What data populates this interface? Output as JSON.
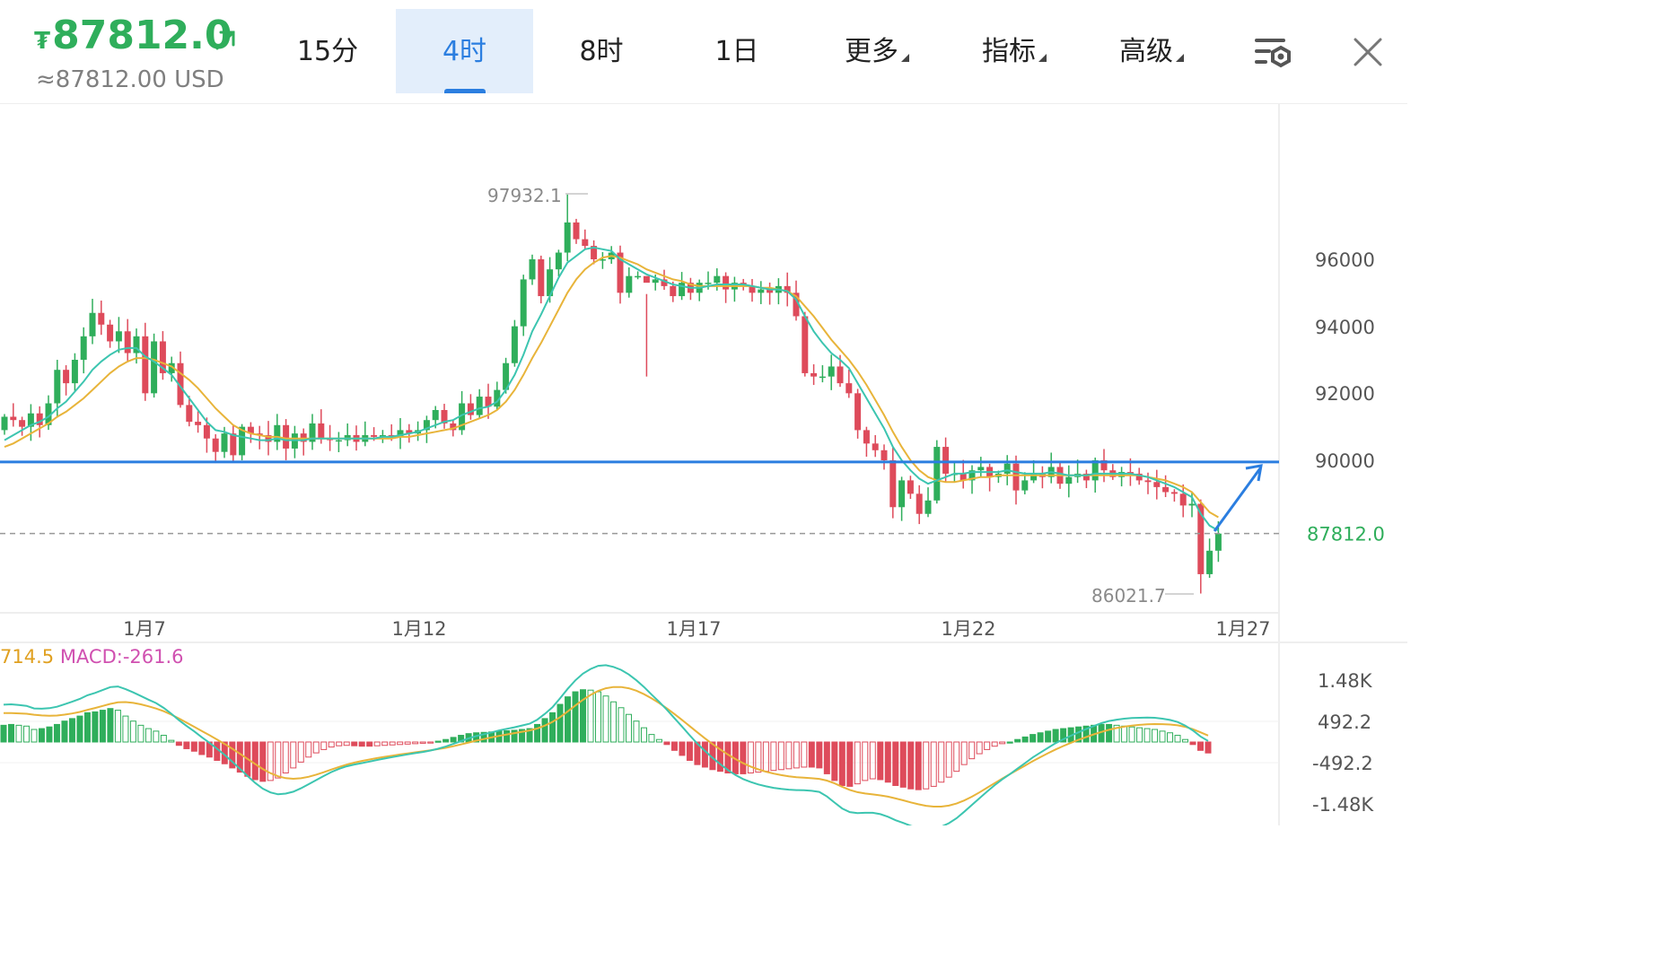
{
  "header": {
    "currency_symbol": "₮",
    "price": "87812.0",
    "converted": "≈87812.00 USD",
    "up_color": "#2fae5b"
  },
  "tabs": [
    {
      "label": "15分",
      "active": false
    },
    {
      "label": "4时",
      "active": true
    },
    {
      "label": "8时",
      "active": false
    },
    {
      "label": "1日",
      "active": false
    },
    {
      "label": "更多",
      "dropdown": true
    },
    {
      "label": "指标",
      "dropdown": true
    },
    {
      "label": "高级",
      "dropdown": true
    }
  ],
  "icons": {
    "settings": "chart-settings-icon",
    "close": "close-icon"
  },
  "chart_data": [
    {
      "type": "candlestick",
      "y_ticks": [
        "96000",
        "94000",
        "92000",
        "90000"
      ],
      "x_ticks": [
        "1月7",
        "1月12",
        "1月17",
        "1月22",
        "1月27"
      ],
      "ylim": [
        85000,
        99000
      ],
      "last_price_label": "87812.0",
      "high_label": "97932.1",
      "low_label": "86021.7",
      "horizontal_line": 89950,
      "colors": {
        "up": "#2fae5b",
        "down": "#de4b5b",
        "ma_fast": "#3cc5b0",
        "ma_slow": "#e8b43a",
        "line": "#2b7ee0"
      },
      "closes": [
        91300,
        91200,
        91000,
        91400,
        91050,
        91700,
        92700,
        92300,
        93000,
        93700,
        94400,
        94050,
        93550,
        93850,
        93200,
        93700,
        92000,
        93550,
        92600,
        92900,
        91650,
        91150,
        91050,
        90650,
        90250,
        90800,
        90150,
        91000,
        90800,
        90750,
        90550,
        91050,
        90350,
        90800,
        90550,
        91100,
        90650,
        90600,
        90600,
        90750,
        90550,
        90750,
        90700,
        90750,
        90700,
        90900,
        90800,
        90900,
        91200,
        91500,
        91100,
        90900,
        91700,
        91350,
        91900,
        91600,
        92100,
        92900,
        94000,
        95400,
        96000,
        94900,
        95700,
        96200,
        97100,
        96600,
        96400,
        96000,
        96000,
        96200,
        95000,
        95500,
        95500,
        95300,
        95400,
        95200,
        94900,
        95300,
        95000,
        95300,
        95300,
        95500,
        95100,
        95300,
        95200,
        95000,
        95100,
        95000,
        95200,
        95000,
        94300,
        92600,
        92500,
        92500,
        92800,
        92300,
        92000,
        90900,
        90500,
        90300,
        90000,
        88600,
        89400,
        89000,
        88400,
        88800,
        90400,
        89600,
        89600,
        89400,
        89700,
        89800,
        89500,
        89600,
        89900,
        89100,
        89400,
        89600,
        89500,
        89800,
        89300,
        89500,
        89600,
        89400,
        90000,
        89700,
        89500,
        89650,
        89600,
        89400,
        89350,
        89200,
        89050,
        89000,
        88650,
        88700,
        86600,
        87300,
        87812
      ],
      "ma_fast": [
        90600,
        90750,
        90900,
        91050,
        91150,
        91300,
        91550,
        91750,
        92050,
        92350,
        92700,
        92950,
        93150,
        93300,
        93350,
        93350,
        93100,
        92950,
        92750,
        92550,
        92200,
        91850,
        91500,
        91150,
        90900,
        90850,
        90750,
        90700,
        90650,
        90600,
        90600,
        90650,
        90600,
        90600,
        90600,
        90650,
        90650,
        90650,
        90650,
        90650,
        90650,
        90650,
        90650,
        90700,
        90700,
        90750,
        90800,
        90850,
        90950,
        91050,
        91150,
        91200,
        91350,
        91450,
        91550,
        91600,
        91750,
        92100,
        92550,
        93150,
        93850,
        94350,
        94900,
        95450,
        95900,
        96100,
        96300,
        96350,
        96300,
        96250,
        96000,
        95850,
        95700,
        95550,
        95450,
        95350,
        95250,
        95200,
        95150,
        95150,
        95200,
        95250,
        95250,
        95250,
        95250,
        95200,
        95150,
        95100,
        95100,
        95050,
        94800,
        94300,
        93850,
        93500,
        93200,
        93000,
        92750,
        92300,
        91850,
        91400,
        90950,
        90400,
        90000,
        89700,
        89450,
        89300,
        89400,
        89500,
        89600,
        89600,
        89650,
        89650,
        89650,
        89650,
        89700,
        89650,
        89600,
        89600,
        89600,
        89650,
        89600,
        89550,
        89550,
        89550,
        89600,
        89600,
        89600,
        89600,
        89600,
        89550,
        89500,
        89400,
        89300,
        89200,
        89050,
        88900,
        88400,
        88050,
        87900
      ],
      "ma_slow": [
        90400,
        90500,
        90650,
        90800,
        90950,
        91100,
        91300,
        91450,
        91650,
        91850,
        92100,
        92350,
        92600,
        92800,
        92950,
        93050,
        93050,
        93000,
        92900,
        92800,
        92600,
        92400,
        92150,
        91850,
        91550,
        91300,
        91050,
        90900,
        90800,
        90750,
        90700,
        90700,
        90650,
        90650,
        90650,
        90650,
        90650,
        90650,
        90650,
        90650,
        90650,
        90650,
        90650,
        90650,
        90650,
        90700,
        90700,
        90750,
        90800,
        90850,
        90900,
        90950,
        91050,
        91150,
        91250,
        91350,
        91500,
        91750,
        92100,
        92550,
        93050,
        93500,
        94000,
        94500,
        95000,
        95400,
        95700,
        95900,
        96050,
        96100,
        96050,
        95950,
        95850,
        95700,
        95600,
        95500,
        95400,
        95350,
        95250,
        95200,
        95200,
        95200,
        95200,
        95200,
        95200,
        95200,
        95150,
        95150,
        95100,
        95050,
        94900,
        94600,
        94300,
        93950,
        93600,
        93300,
        93000,
        92650,
        92250,
        91800,
        91350,
        90850,
        90400,
        90000,
        89700,
        89500,
        89400,
        89350,
        89350,
        89400,
        89450,
        89500,
        89500,
        89550,
        89550,
        89550,
        89550,
        89550,
        89550,
        89550,
        89550,
        89550,
        89550,
        89550,
        89550,
        89550,
        89550,
        89550,
        89550,
        89550,
        89500,
        89450,
        89400,
        89300,
        89200,
        89050,
        88750,
        88450,
        88300
      ]
    },
    {
      "type": "bar",
      "legend": {
        "dea_partial": "714.5",
        "macd_label": "MACD:",
        "macd_value": "-261.6"
      },
      "y_ticks": [
        "1.48K",
        "492.2",
        "-492.2",
        "-1.48K"
      ],
      "ylim": [
        -1480,
        1480
      ],
      "colors": {
        "pos": "#2fae5b",
        "neg": "#de4b5b",
        "dif": "#3cc5b0",
        "dea": "#e8b43a"
      },
      "hist": [
        400,
        420,
        400,
        380,
        300,
        320,
        360,
        420,
        500,
        560,
        620,
        700,
        720,
        760,
        800,
        760,
        620,
        500,
        400,
        320,
        260,
        160,
        40,
        -80,
        -160,
        -220,
        -300,
        -360,
        -440,
        -520,
        -620,
        -720,
        -820,
        -900,
        -940,
        -920,
        -860,
        -740,
        -620,
        -480,
        -360,
        -260,
        -180,
        -120,
        -90,
        -80,
        -90,
        -100,
        -100,
        -90,
        -80,
        -70,
        -60,
        -50,
        -40,
        -30,
        -10,
        20,
        60,
        110,
        160,
        200,
        220,
        230,
        240,
        260,
        270,
        280,
        300,
        320,
        420,
        560,
        700,
        900,
        1080,
        1200,
        1250,
        1240,
        1200,
        1100,
        960,
        820,
        660,
        500,
        340,
        180,
        60,
        -60,
        -200,
        -320,
        -440,
        -540,
        -600,
        -660,
        -700,
        -740,
        -760,
        -760,
        -740,
        -720,
        -700,
        -680,
        -660,
        -640,
        -620,
        -600,
        -600,
        -620,
        -760,
        -920,
        -1040,
        -1060,
        -1000,
        -920,
        -880,
        -900,
        -960,
        -1040,
        -1080,
        -1120,
        -1140,
        -1120,
        -1060,
        -960,
        -840,
        -700,
        -540,
        -400,
        -280,
        -180,
        -100,
        -40,
        0,
        60,
        120,
        180,
        220,
        260,
        300,
        320,
        340,
        360,
        380,
        400,
        420,
        420,
        400,
        380,
        360,
        340,
        320,
        300,
        260,
        220,
        160,
        60,
        -60,
        -200,
        -262
      ]
    }
  ]
}
